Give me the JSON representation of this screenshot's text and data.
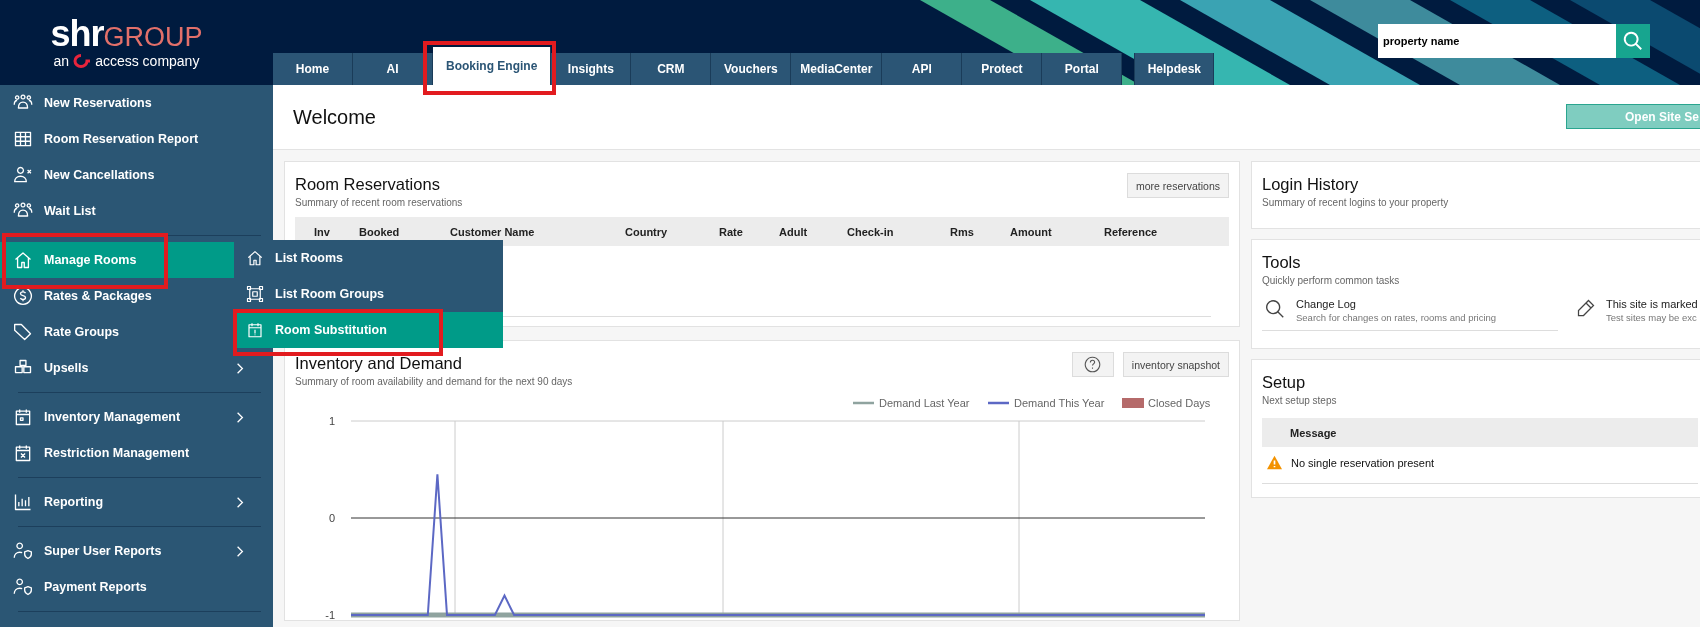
{
  "header": {
    "logo": {
      "brand": "shr",
      "brand_suffix": "GROUP",
      "tagline_before": "an",
      "tagline_after": "access company"
    },
    "search": {
      "value": "property name"
    }
  },
  "tabs": [
    {
      "label": "Home",
      "selected": false,
      "highlighted": false,
      "detached": false
    },
    {
      "label": "AI",
      "selected": false,
      "highlighted": false,
      "detached": false
    },
    {
      "label": "Booking Engine",
      "selected": true,
      "highlighted": true,
      "detached": false
    },
    {
      "label": "Insights",
      "selected": false,
      "highlighted": false,
      "detached": false
    },
    {
      "label": "CRM",
      "selected": false,
      "highlighted": false,
      "detached": false
    },
    {
      "label": "Vouchers",
      "selected": false,
      "highlighted": false,
      "detached": false
    },
    {
      "label": "MediaCenter",
      "selected": false,
      "highlighted": false,
      "detached": false
    },
    {
      "label": "API",
      "selected": false,
      "highlighted": false,
      "detached": false
    },
    {
      "label": "Protect",
      "selected": false,
      "highlighted": false,
      "detached": false
    },
    {
      "label": "Portal",
      "selected": false,
      "highlighted": false,
      "detached": false
    },
    {
      "label": "Helpdesk",
      "selected": false,
      "highlighted": false,
      "detached": true
    }
  ],
  "sidebar": {
    "groups": [
      {
        "items": [
          {
            "label": "New Reservations",
            "selected": false,
            "highlighted": false,
            "has_submenu": false
          },
          {
            "label": "Room Reservation Report",
            "selected": false,
            "highlighted": false,
            "has_submenu": false
          },
          {
            "label": "New Cancellations",
            "selected": false,
            "highlighted": false,
            "has_submenu": false
          },
          {
            "label": "Wait List",
            "selected": false,
            "highlighted": false,
            "has_submenu": false
          }
        ]
      },
      {
        "items": [
          {
            "label": "Manage Rooms",
            "selected": true,
            "highlighted": true,
            "has_submenu": false
          },
          {
            "label": "Rates & Packages",
            "selected": false,
            "highlighted": false
          },
          {
            "label": "Rate Groups",
            "selected": false,
            "highlighted": false
          },
          {
            "label": "Upsells",
            "selected": false,
            "highlighted": false,
            "has_submenu": true
          }
        ]
      },
      {
        "items": [
          {
            "label": "Inventory Management",
            "selected": false,
            "highlighted": false,
            "has_submenu": true
          },
          {
            "label": "Restriction Management",
            "selected": false,
            "highlighted": false,
            "has_submenu": false
          }
        ]
      },
      {
        "items": [
          {
            "label": "Reporting",
            "selected": false,
            "highlighted": false,
            "has_submenu": true
          }
        ]
      },
      {
        "items": [
          {
            "label": "Super User Reports",
            "selected": false,
            "highlighted": false,
            "has_submenu": true
          },
          {
            "label": "Payment Reports",
            "selected": false,
            "highlighted": false,
            "has_submenu": false
          }
        ]
      }
    ]
  },
  "submenu": {
    "items": [
      {
        "label": "List Rooms",
        "selected": false,
        "highlighted": false
      },
      {
        "label": "List Room Groups",
        "selected": false,
        "highlighted": false
      },
      {
        "label": "Room Substitution",
        "selected": true,
        "highlighted": true
      }
    ]
  },
  "page": {
    "title": "Welcome",
    "action": "Open Site Se"
  },
  "room_reservations": {
    "title": "Room Reservations",
    "subtitle": "Summary of recent room reservations",
    "button": "more reservations",
    "columns": [
      "Inv",
      "Booked",
      "Customer Name",
      "Country",
      "Rate",
      "Adult",
      "Check-in",
      "Rms",
      "Amount",
      "Reference"
    ]
  },
  "inventory": {
    "title": "Inventory and Demand",
    "subtitle": "Summary of room availability and demand for the next 90 days",
    "button": "inventory snapshot",
    "chart_data": {
      "type": "line",
      "legend": "top-right",
      "ylim": [
        -1,
        1
      ],
      "yticks": [
        -1,
        0,
        1
      ],
      "series": [
        {
          "name": "Demand Last Year",
          "color": "#8fa39f",
          "values": [
            -1,
            -1,
            -1,
            -1,
            -1,
            -1,
            -1,
            -1,
            -1,
            -1,
            -1,
            -1,
            -1,
            -1,
            -1,
            -1,
            -1,
            -1,
            -1,
            -1,
            -1,
            -1,
            -1,
            -1,
            -1,
            -1,
            -1,
            -1,
            -1,
            -1,
            -1,
            -1,
            -1,
            -1,
            -1,
            -1,
            -1,
            -1,
            -1,
            -1,
            -1,
            -1,
            -1,
            -1,
            -1,
            -1,
            -1,
            -1,
            -1,
            -1,
            -1,
            -1,
            -1,
            -1,
            -1,
            -1,
            -1,
            -1,
            -1,
            -1,
            -1,
            -1,
            -1,
            -1,
            -1,
            -1,
            -1,
            -1,
            -1,
            -1,
            -1,
            -1,
            -1,
            -1,
            -1,
            -1,
            -1,
            -1,
            -1,
            -1,
            -1,
            -1,
            -1,
            -1,
            -1,
            -1,
            -1,
            -1,
            -1,
            -1
          ]
        },
        {
          "name": "Demand This Year",
          "color": "#5c68c4",
          "values": [
            -1,
            -1,
            -1,
            -1,
            -1,
            -1,
            -1,
            -1,
            -1,
            0.45,
            -1,
            -1,
            -1,
            -1,
            -1,
            -1,
            -0.8,
            -1,
            -1,
            -1,
            -1,
            -1,
            -1,
            -1,
            -1,
            -1,
            -1,
            -1,
            -1,
            -1,
            -1,
            -1,
            -1,
            -1,
            -1,
            -1,
            -1,
            -1,
            -1,
            -1,
            -1,
            -1,
            -1,
            -1,
            -1,
            -1,
            -1,
            -1,
            -1,
            -1,
            -1,
            -1,
            -1,
            -1,
            -1,
            -1,
            -1,
            -1,
            -1,
            -1,
            -1,
            -1,
            -1,
            -1,
            -1,
            -1,
            -1,
            -1,
            -1,
            -1,
            -1,
            -1,
            -1,
            -1,
            -1,
            -1,
            -1,
            -1,
            -1,
            -1,
            -1,
            -1,
            -1,
            -1,
            -1,
            -1,
            -1,
            -1,
            -1,
            -1
          ]
        },
        {
          "name": "Closed Days",
          "color": "#b56a6a",
          "values": [
            null,
            null,
            null,
            null,
            null,
            null,
            null,
            null,
            null,
            null,
            null,
            null,
            null,
            null,
            null,
            null,
            null,
            null,
            null,
            null,
            null,
            null,
            null,
            null,
            null,
            null,
            null,
            null,
            null,
            null,
            null,
            null,
            null,
            null,
            null,
            null,
            null,
            null,
            null,
            null,
            null,
            null,
            null,
            null,
            null,
            null,
            null,
            null,
            null,
            null,
            null,
            null,
            null,
            null,
            null,
            null,
            null,
            null,
            null,
            null,
            null,
            null,
            null,
            null,
            null,
            null,
            null,
            null,
            null,
            null,
            null,
            null,
            null,
            null,
            null,
            null,
            null,
            null,
            null,
            null,
            null,
            null,
            null,
            null,
            null,
            null,
            null,
            null,
            null,
            null
          ]
        }
      ]
    }
  },
  "login_history": {
    "title": "Login History",
    "subtitle": "Summary of recent logins to your property"
  },
  "tools": {
    "title": "Tools",
    "subtitle": "Quickly perform common tasks",
    "items": [
      {
        "title": "Change Log",
        "description": "Search for changes on rates, rooms and pricing"
      },
      {
        "title": "This site is marked",
        "description": "Test sites may be exc"
      }
    ]
  },
  "setup": {
    "title": "Setup",
    "subtitle": "Next setup steps",
    "columns": [
      "Message"
    ],
    "rows": [
      {
        "kind": "warning",
        "message": "No single reservation present"
      }
    ]
  }
}
